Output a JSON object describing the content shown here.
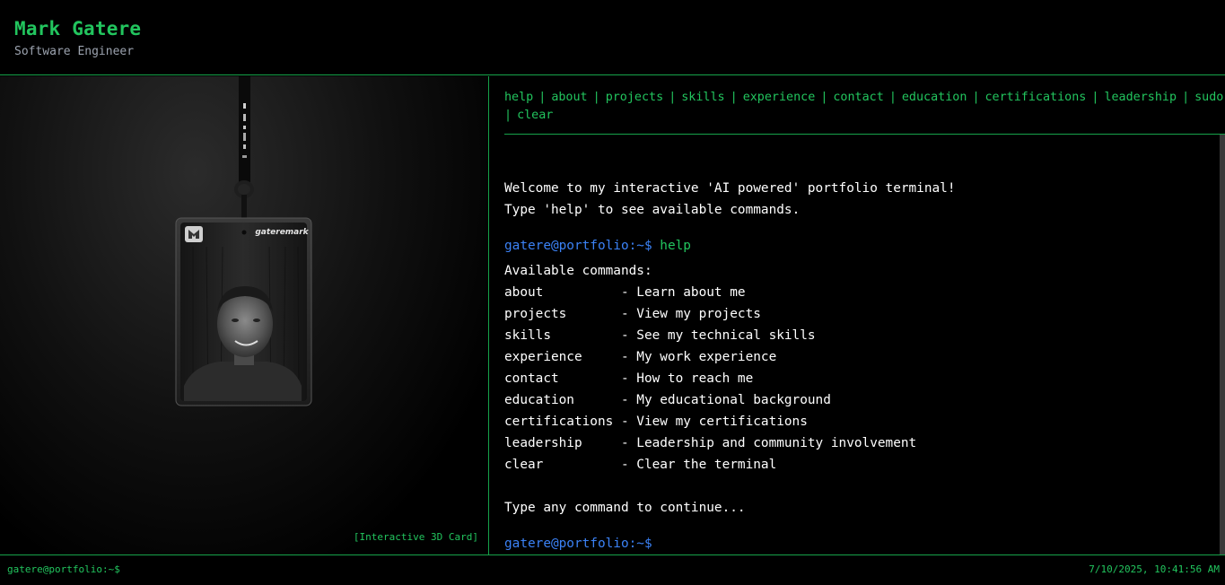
{
  "header": {
    "name": "Mark Gatere",
    "role": "Software Engineer"
  },
  "card": {
    "brand": "gateremark",
    "caption": "[Interactive 3D Card]"
  },
  "nav": {
    "row1": [
      "help",
      "about",
      "projects",
      "skills",
      "experience",
      "contact",
      "education",
      "certifications",
      "leadership",
      "sudo"
    ],
    "row2": [
      "clear"
    ],
    "separator": "|"
  },
  "terminal": {
    "welcome_1": "Welcome to my interactive 'AI powered' portfolio terminal!",
    "welcome_2": "Type 'help' to see available commands.",
    "prompt": "gatere@portfolio:~$",
    "typed_command": "help",
    "commands_header": "Available commands:",
    "commands": [
      {
        "name": "about",
        "desc": "Learn about me"
      },
      {
        "name": "projects",
        "desc": "View my projects"
      },
      {
        "name": "skills",
        "desc": "See my technical skills"
      },
      {
        "name": "experience",
        "desc": "My work experience"
      },
      {
        "name": "contact",
        "desc": "How to reach me"
      },
      {
        "name": "education",
        "desc": "My educational background"
      },
      {
        "name": "certifications",
        "desc": "View my certifications"
      },
      {
        "name": "leadership",
        "desc": "Leadership and community involvement"
      },
      {
        "name": "clear",
        "desc": "Clear the terminal"
      }
    ],
    "continue_text": "Type any command to continue..."
  },
  "footer": {
    "prompt": "gatere@portfolio:~$",
    "datetime": "7/10/2025, 10:41:56 AM"
  },
  "colors": {
    "accent_green": "#22c55e",
    "prompt_blue": "#3b82f6",
    "border_green": "#16a34a"
  }
}
